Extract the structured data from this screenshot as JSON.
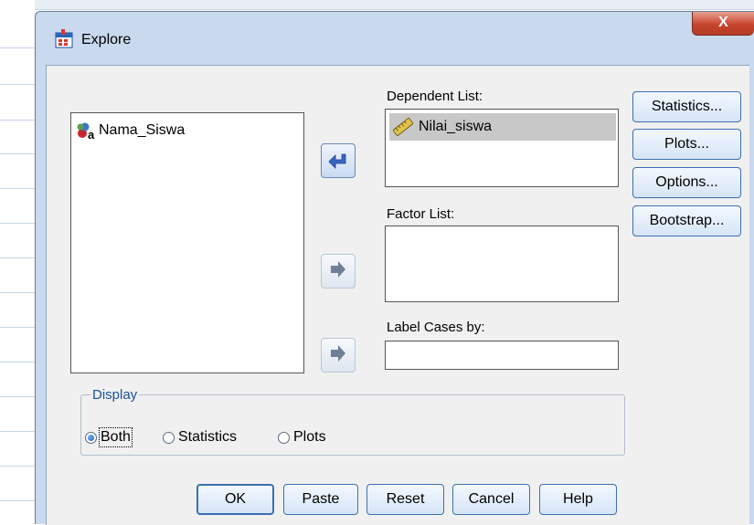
{
  "window": {
    "title": "Explore",
    "close_label": "X"
  },
  "source_list": {
    "items": [
      {
        "label": "Nama_Siswa",
        "icon": "nominal-string-variable-icon"
      }
    ]
  },
  "dependent_list": {
    "label": "Dependent List:",
    "items": [
      {
        "label": "Nilai_siswa",
        "icon": "scale-ruler-icon",
        "selected": true
      }
    ]
  },
  "factor_list": {
    "label": "Factor List:",
    "items": []
  },
  "label_cases": {
    "label": "Label Cases by:",
    "value": ""
  },
  "side_buttons": {
    "statistics": "Statistics...",
    "plots": "Plots...",
    "options": "Options...",
    "bootstrap": "Bootstrap..."
  },
  "display": {
    "title": "Display",
    "options": [
      {
        "label": "Both",
        "checked": true
      },
      {
        "label": "Statistics",
        "checked": false
      },
      {
        "label": "Plots",
        "checked": false
      }
    ]
  },
  "bottom_buttons": {
    "ok": "OK",
    "paste": "Paste",
    "reset": "Reset",
    "cancel": "Cancel",
    "help": "Help"
  },
  "colors": {
    "accent": "#3c6fb0",
    "selection": "#c8c8c8",
    "group_title": "#1b4f9a",
    "close": "#c7452e"
  }
}
